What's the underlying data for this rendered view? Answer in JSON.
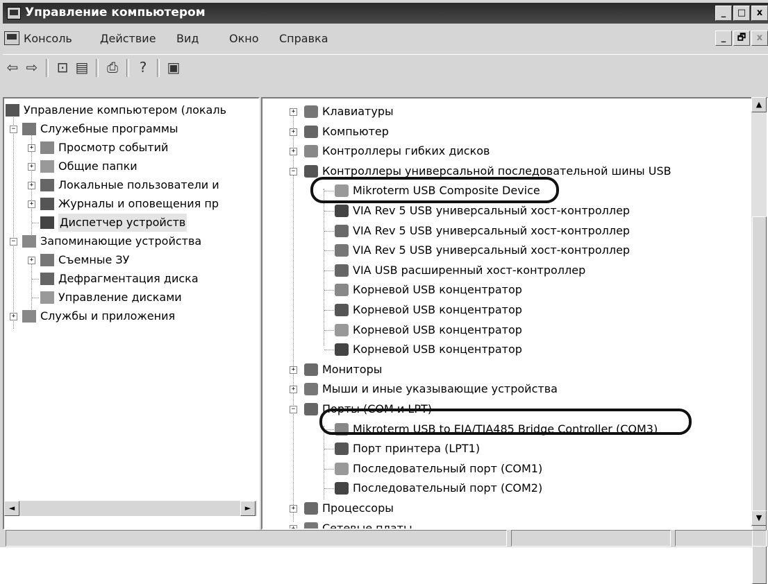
{
  "window": {
    "title": "Управление компьютером"
  },
  "title_buttons": [
    "_",
    "□",
    "x"
  ],
  "menu": [
    "Консоль",
    "Действие",
    "Вид",
    "Окно",
    "Справка"
  ],
  "mdi_buttons": [
    "_",
    "🗗",
    "x"
  ],
  "toolbar_icons": [
    "back-arrow-icon",
    "forward-arrow-icon",
    "up-folder-icon",
    "show-hide-tree-icon",
    "print-icon",
    "help-icon",
    "properties-icon"
  ],
  "left_tree": {
    "root": "Управление компьютером (локаль",
    "items": [
      {
        "label": "Служебные программы",
        "expander": "−"
      },
      {
        "label": "Просмотр событий",
        "expander": "+"
      },
      {
        "label": "Общие папки",
        "expander": "+"
      },
      {
        "label": "Локальные пользователи и",
        "expander": "+"
      },
      {
        "label": "Журналы и оповещения пр",
        "expander": "+"
      },
      {
        "label": "Диспетчер устройств",
        "expander": ""
      },
      {
        "label": "Запоминающие устройства",
        "expander": "−"
      },
      {
        "label": "Съемные ЗУ",
        "expander": "+"
      },
      {
        "label": "Дефрагментация диска",
        "expander": ""
      },
      {
        "label": "Управление дисками",
        "expander": ""
      },
      {
        "label": "Службы и приложения",
        "expander": "+"
      }
    ]
  },
  "device_tree": [
    {
      "label": "Клавиатуры",
      "expander": "+",
      "icon": "keyboard-icon"
    },
    {
      "label": "Компьютер",
      "expander": "+",
      "icon": "computer-icon"
    },
    {
      "label": "Контроллеры гибких дисков",
      "expander": "+",
      "icon": "floppy-controller-icon"
    },
    {
      "label": "Контроллеры универсальной последовательной шины USB",
      "expander": "−",
      "icon": "usb-icon"
    },
    {
      "label": "Mikroterm USB Composite Device",
      "expander": "",
      "icon": "usb-icon"
    },
    {
      "label": "VIA Rev 5 USB универсальный хост-контроллер",
      "expander": "",
      "icon": "usb-icon"
    },
    {
      "label": "VIA Rev 5 USB универсальный хост-контроллер",
      "expander": "",
      "icon": "usb-icon"
    },
    {
      "label": "VIA Rev 5 USB универсальный хост-контроллер",
      "expander": "",
      "icon": "usb-icon"
    },
    {
      "label": "VIA USB расширенный хост-контроллер",
      "expander": "",
      "icon": "usb-icon"
    },
    {
      "label": "Корневой USB концентратор",
      "expander": "",
      "icon": "usb-icon"
    },
    {
      "label": "Корневой USB концентратор",
      "expander": "",
      "icon": "usb-icon"
    },
    {
      "label": "Корневой USB концентратор",
      "expander": "",
      "icon": "usb-icon"
    },
    {
      "label": "Корневой USB концентратор",
      "expander": "",
      "icon": "usb-icon"
    },
    {
      "label": "Мониторы",
      "expander": "+",
      "icon": "monitor-icon"
    },
    {
      "label": "Мыши и иные указывающие устройства",
      "expander": "+",
      "icon": "mouse-icon"
    },
    {
      "label": "Порты (COM и LPT)",
      "expander": "−",
      "icon": "port-icon"
    },
    {
      "label": "Mikroterm USB to EIA/TIA485 Bridge Controller (COM3)",
      "expander": "",
      "icon": "port-icon"
    },
    {
      "label": "Порт принтера (LPT1)",
      "expander": "",
      "icon": "port-icon"
    },
    {
      "label": "Последовательный порт (COM1)",
      "expander": "",
      "icon": "port-icon"
    },
    {
      "label": "Последовательный порт (COM2)",
      "expander": "",
      "icon": "port-icon"
    },
    {
      "label": "Процессоры",
      "expander": "+",
      "icon": "processor-icon"
    },
    {
      "label": "Сетевые платы",
      "expander": "+",
      "icon": "network-card-icon"
    }
  ],
  "scroll_arrows": {
    "left": "◄",
    "right": "►",
    "up": "▲",
    "down": "▼"
  }
}
